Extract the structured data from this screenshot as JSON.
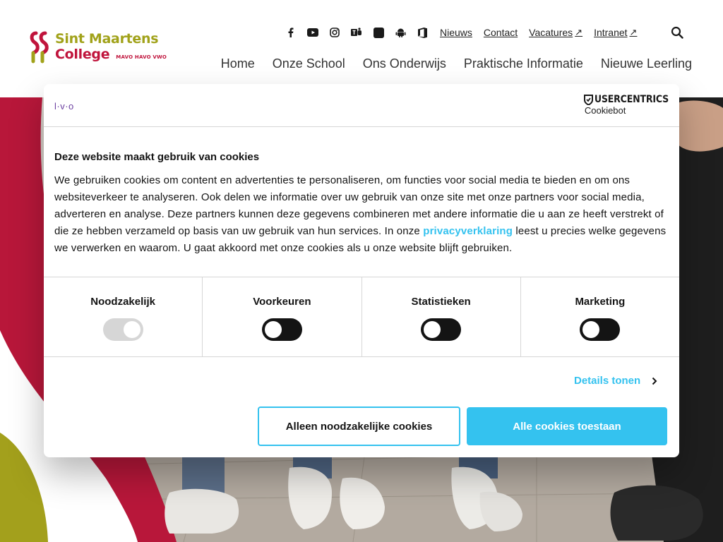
{
  "header": {
    "logo": {
      "line1": "Sint Maartens",
      "line2": "College",
      "levels": "MAVO HAVO VWO"
    },
    "social_icons": [
      "facebook-icon",
      "youtube-icon",
      "instagram-icon",
      "teams-icon",
      "tablet-icon",
      "android-icon",
      "office-icon"
    ],
    "top_links": [
      {
        "label": "Nieuws",
        "external": false
      },
      {
        "label": "Contact",
        "external": false
      },
      {
        "label": "Vacatures",
        "external": true,
        "icon": "↗"
      },
      {
        "label": "Intranet",
        "external": true,
        "icon": "↗"
      }
    ],
    "nav": [
      "Home",
      "Onze School",
      "Ons Onderwijs",
      "Praktische Informatie",
      "Nieuwe Leerling"
    ]
  },
  "cookie_dialog": {
    "brand": "l·v·o",
    "provider": {
      "name": "USERCENTRICS",
      "sub": "Cookiebot"
    },
    "title": "Deze website maakt gebruik van cookies",
    "text_before_link": "We gebruiken cookies om content en advertenties te personaliseren, om functies voor social media te bieden en om ons websiteverkeer te analyseren. Ook delen we informatie over uw gebruik van onze site met onze partners voor social media, adverteren en analyse. Deze partners kunnen deze gegevens combineren met andere informatie die u aan ze heeft verstrekt of die ze hebben verzameld op basis van uw gebruik van hun services. In onze ",
    "link_text": "privacyverklaring",
    "text_after_link": " leest u precies welke gegevens we verwerken en waarom. U gaat akkoord met onze cookies als u onze website blijft gebruiken.",
    "categories": [
      {
        "label": "Noodzakelijk",
        "enabled": true,
        "locked": true
      },
      {
        "label": "Voorkeuren",
        "enabled": false,
        "locked": false
      },
      {
        "label": "Statistieken",
        "enabled": false,
        "locked": false
      },
      {
        "label": "Marketing",
        "enabled": false,
        "locked": false
      }
    ],
    "details_label": "Details tonen",
    "buttons": {
      "necessary": "Alleen noodzakelijke cookies",
      "allow_all": "Alle cookies toestaan"
    }
  },
  "colors": {
    "accent": "#34c2ef",
    "brand_red": "#c0143c",
    "brand_olive": "#a1a21a"
  }
}
